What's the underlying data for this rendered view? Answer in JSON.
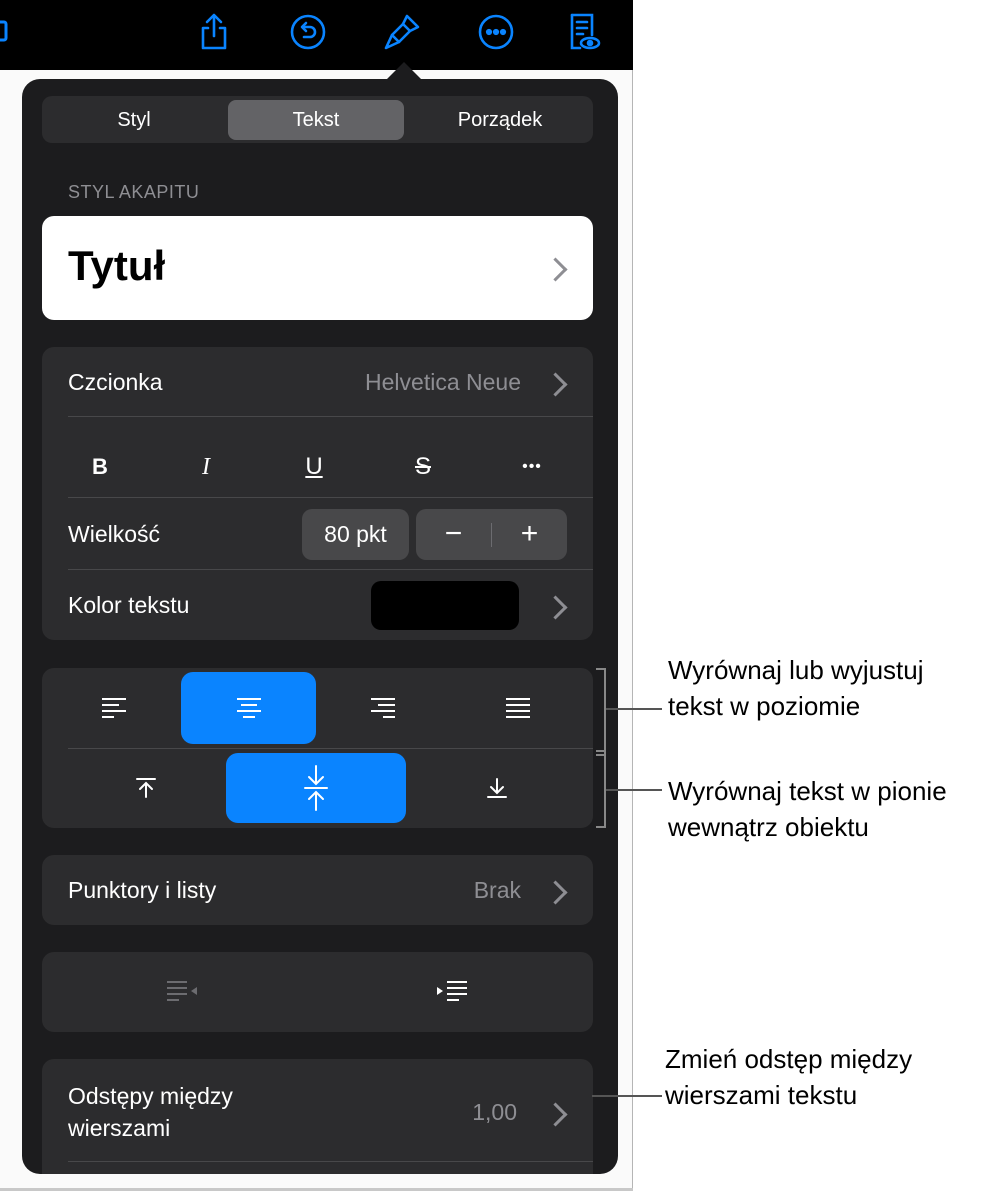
{
  "toolbar": {
    "icons": [
      "media-icon",
      "share-icon",
      "undo-icon",
      "format-brush-icon",
      "more-icon",
      "reader-view-icon"
    ]
  },
  "tabs": {
    "style": "Styl",
    "text": "Tekst",
    "arrange": "Porządek",
    "active": "Tekst"
  },
  "paragraph_style": {
    "label": "STYL AKAPITU",
    "value": "Tytuł"
  },
  "font": {
    "label": "Czcionka",
    "value": "Helvetica Neue",
    "bold": "B",
    "italic": "I",
    "underline": "U",
    "strike": "S",
    "more": "•••"
  },
  "size": {
    "label": "Wielkość",
    "value": "80 pkt",
    "minus": "−",
    "plus": "+"
  },
  "color": {
    "label": "Kolor tekstu",
    "swatch": "#000000"
  },
  "alignment": {
    "horizontal_selected": "center",
    "vertical_selected": "middle"
  },
  "bullets": {
    "label": "Punktory i listy",
    "value": "Brak"
  },
  "spacing": {
    "label_line1": "Odstępy między",
    "label_line2": "wierszami",
    "value": "1,00"
  },
  "callouts": {
    "horizontal_line1": "Wyrównaj lub wyjustuj",
    "horizontal_line2": "tekst w poziomie",
    "vertical_line1": "Wyrównaj tekst w pionie",
    "vertical_line2": "wewnątrz obiektu",
    "spacing_line1": "Zmień odstęp między",
    "spacing_line2": "wierszami tekstu"
  },
  "colors": {
    "accent": "#0a84ff",
    "panel": "#1c1c1e",
    "group": "#2c2c2e"
  }
}
